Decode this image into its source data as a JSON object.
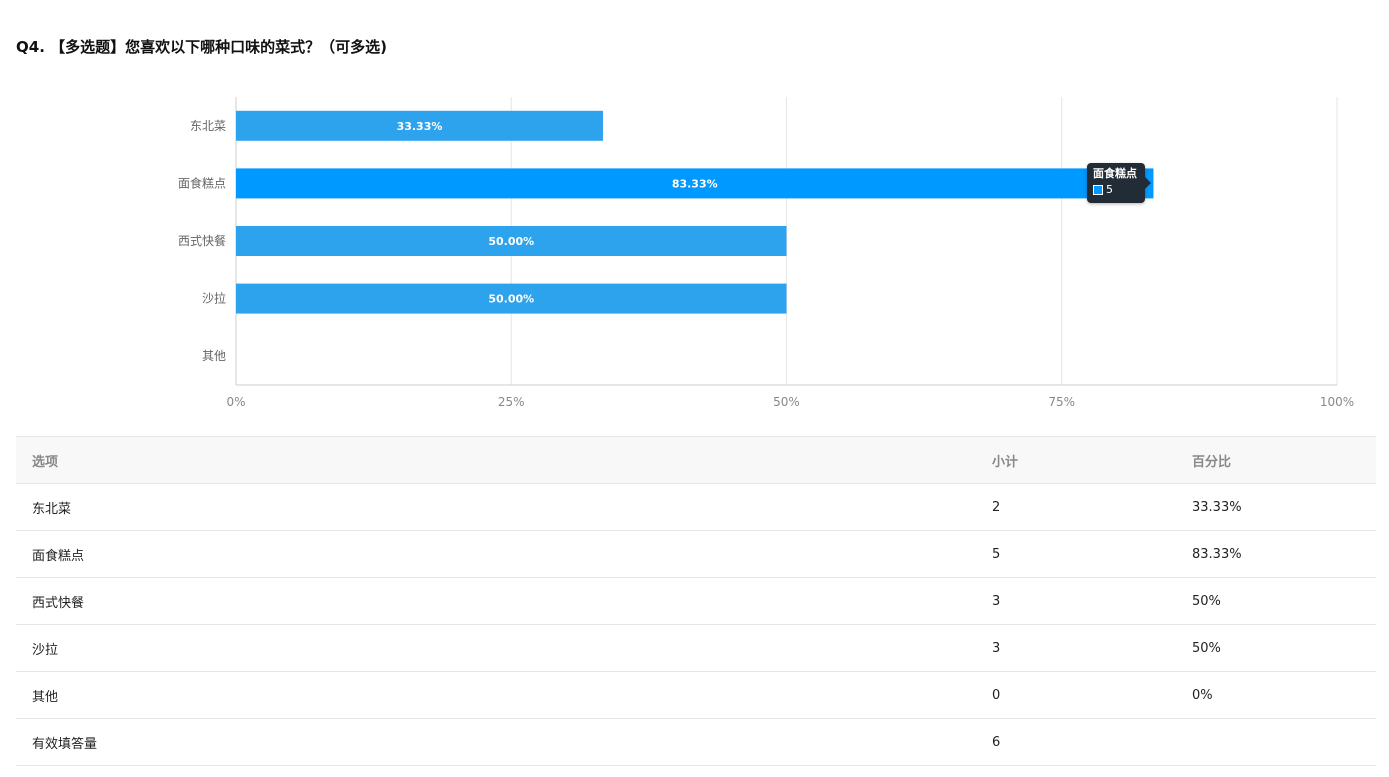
{
  "question": {
    "title": "Q4. 【多选题】您喜欢以下哪种口味的菜式？（可多选)"
  },
  "chart_data": {
    "type": "bar",
    "orientation": "horizontal",
    "categories": [
      "东北菜",
      "面食糕点",
      "西式快餐",
      "沙拉",
      "其他"
    ],
    "values": [
      33.33,
      83.33,
      50.0,
      50.0,
      0
    ],
    "counts": [
      2,
      5,
      3,
      3,
      0
    ],
    "data_labels": [
      "33.33%",
      "83.33%",
      "50.00%",
      "50.00%",
      ""
    ],
    "xlim": [
      0,
      100
    ],
    "x_ticks": [
      "0%",
      "25%",
      "50%",
      "75%",
      "100%"
    ],
    "grid": true,
    "highlighted_index": 1,
    "colors": {
      "bar": "#2ea3ed",
      "bar_highlight": "#0099ff",
      "grid": "#e6e6e6",
      "axis": "#cccccc"
    },
    "tooltip": {
      "name": "面食糕点",
      "value": "5"
    }
  },
  "table": {
    "headers": [
      "选项",
      "小计",
      "百分比"
    ],
    "rows": [
      [
        "东北菜",
        "2",
        "33.33%"
      ],
      [
        "面食糕点",
        "5",
        "83.33%"
      ],
      [
        "西式快餐",
        "3",
        "50%"
      ],
      [
        "沙拉",
        "3",
        "50%"
      ],
      [
        "其他",
        "0",
        "0%"
      ],
      [
        "有效填答量",
        "6",
        ""
      ]
    ]
  }
}
